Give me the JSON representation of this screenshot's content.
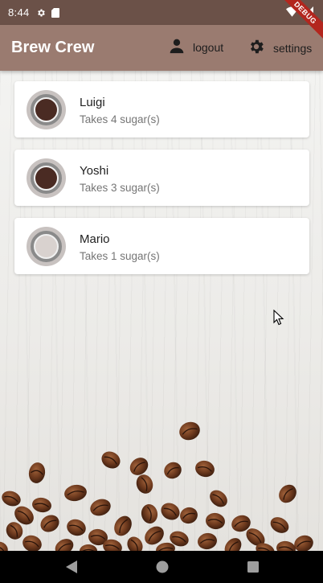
{
  "status_bar": {
    "time": "8:44",
    "debug_label": "DEBUG",
    "icons": [
      "gear-icon",
      "sd-card-icon",
      "wifi-icon",
      "signal-icon"
    ]
  },
  "app_bar": {
    "title": "Brew Crew",
    "logout_label": "logout",
    "settings_label": "settings",
    "color": "#9a7b70"
  },
  "brews": [
    {
      "name": "Luigi",
      "sugars_text": "Takes 4 sugar(s)",
      "strength_color": "#4a2b23"
    },
    {
      "name": "Yoshi",
      "sugars_text": "Takes 3 sugar(s)",
      "strength_color": "#4a2b23"
    },
    {
      "name": "Mario",
      "sugars_text": "Takes 1 sugar(s)",
      "strength_color": "#d9d2cf"
    }
  ],
  "nav_bar": {
    "icons": [
      "back-icon",
      "home-icon",
      "recents-icon"
    ]
  }
}
